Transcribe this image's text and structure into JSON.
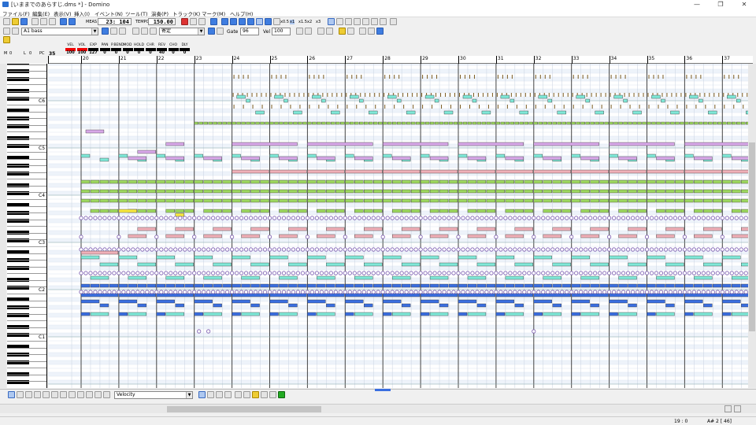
{
  "window": {
    "title": "[いままでのあらすじ.dms *] - Domino",
    "controls": [
      "—",
      "❐",
      "✕"
    ]
  },
  "menu": [
    "ファイル(F)",
    "編集(E)",
    "表示(V)",
    "挿入(I)",
    "イベント(N)",
    "ツール(T)",
    "演奏(P)",
    "トラック(K)",
    "マーク(M)",
    "ヘルプ(H)"
  ],
  "toolbar1": {
    "meas_label": "MEAS",
    "meas_value": "23: 104",
    "tempo_label": "TEMPO",
    "tempo_value": "150.00",
    "speed_buttons": [
      "x0.5",
      "x1",
      "x1.5",
      "x2",
      "x3"
    ]
  },
  "toolbar2": {
    "track_name": "A1 bass",
    "instrument": "Eb",
    "channel": "寄定",
    "gate_label": "Gate",
    "gate_value": "96",
    "vel_label": "Vel",
    "vel_value": "100"
  },
  "controls_strip": {
    "m_label": "M",
    "m_value": "0",
    "l_label": "L",
    "l_value": "0",
    "pc_label": "PC",
    "pc_value": "35",
    "params": [
      {
        "name": "VEL",
        "value": "100",
        "red": true
      },
      {
        "name": "VOL",
        "value": "100",
        "red": true
      },
      {
        "name": "EXP",
        "value": "127",
        "red": false
      },
      {
        "name": "PAN",
        "value": "0",
        "red": false
      },
      {
        "name": "P.BEND",
        "value": "0",
        "red": false
      },
      {
        "name": "MOD",
        "value": "0",
        "red": false
      },
      {
        "name": "HOLD",
        "value": "0",
        "red": false
      },
      {
        "name": "CHR",
        "value": "0",
        "red": false
      },
      {
        "name": "REV",
        "value": "40",
        "red": false
      },
      {
        "name": "CHO",
        "value": "0",
        "red": false
      },
      {
        "name": "DLY",
        "value": "0",
        "red": false
      }
    ]
  },
  "ruler": {
    "bars": [
      "20",
      "21",
      "22",
      "23",
      "24",
      "25",
      "26",
      "27",
      "28",
      "29",
      "30",
      "31",
      "32",
      "33",
      "34",
      "35",
      "36",
      "37"
    ]
  },
  "keyboard": {
    "octave_labels": [
      "C6",
      "C5",
      "C4",
      "C3",
      "C2",
      "C1"
    ]
  },
  "bottom_toolbar": {
    "event_type": "Velocity"
  },
  "status": {
    "position": "19 : 0",
    "note": "A# 2 [ 46]"
  },
  "colors": {
    "cyan": "#7fe8d8",
    "green": "#9ed860",
    "pink": "#f0b0b8",
    "magenta": "#d8a8e8",
    "blue": "#3a6ee0",
    "yellow": "#f8e840",
    "brown": "#7a5a20"
  }
}
